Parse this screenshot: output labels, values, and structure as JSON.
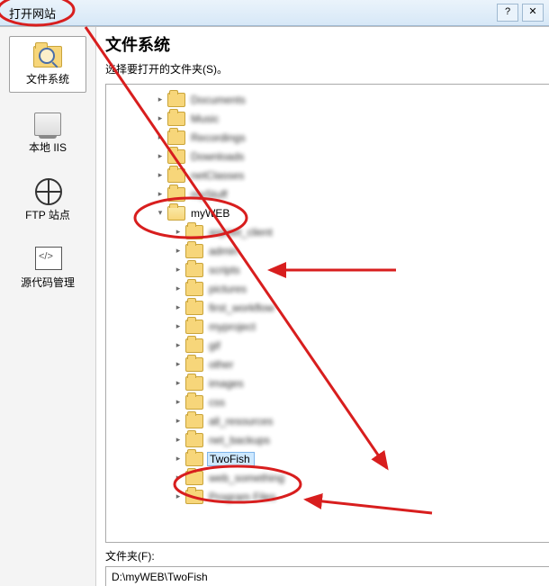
{
  "window": {
    "title": "打开网站"
  },
  "sidebar": {
    "items": [
      {
        "label": "文件系统",
        "icon": "folder-search-icon",
        "selected": true
      },
      {
        "label": "本地 IIS",
        "icon": "server-icon",
        "selected": false
      },
      {
        "label": "FTP 站点",
        "icon": "globe-icon",
        "selected": false
      },
      {
        "label": "源代码管理",
        "icon": "source-control-icon",
        "selected": false
      }
    ]
  },
  "main": {
    "heading": "文件系统",
    "subheading": "选择要打开的文件夹(S)。",
    "folder_field_label": "文件夹(F):",
    "folder_path": "D:\\myWEB\\TwoFish"
  },
  "tree": {
    "top_blurred": [
      "Documents",
      "Music",
      "Recordings",
      "Downloads",
      "netClasses",
      "myStuff"
    ],
    "myweb_label": "myWEB",
    "myweb_children_blurred": [
      "aspnet_client",
      "admin",
      "scripts",
      "pictures",
      "first_workflow",
      "myproject",
      "gif",
      "other",
      "images",
      "css",
      "all_resources",
      "net_backups"
    ],
    "twofish_label": "TwoFish",
    "after_twofish_blurred": [
      "web_something",
      "Program Files"
    ]
  },
  "annotation": {
    "color": "#d81e1e"
  }
}
